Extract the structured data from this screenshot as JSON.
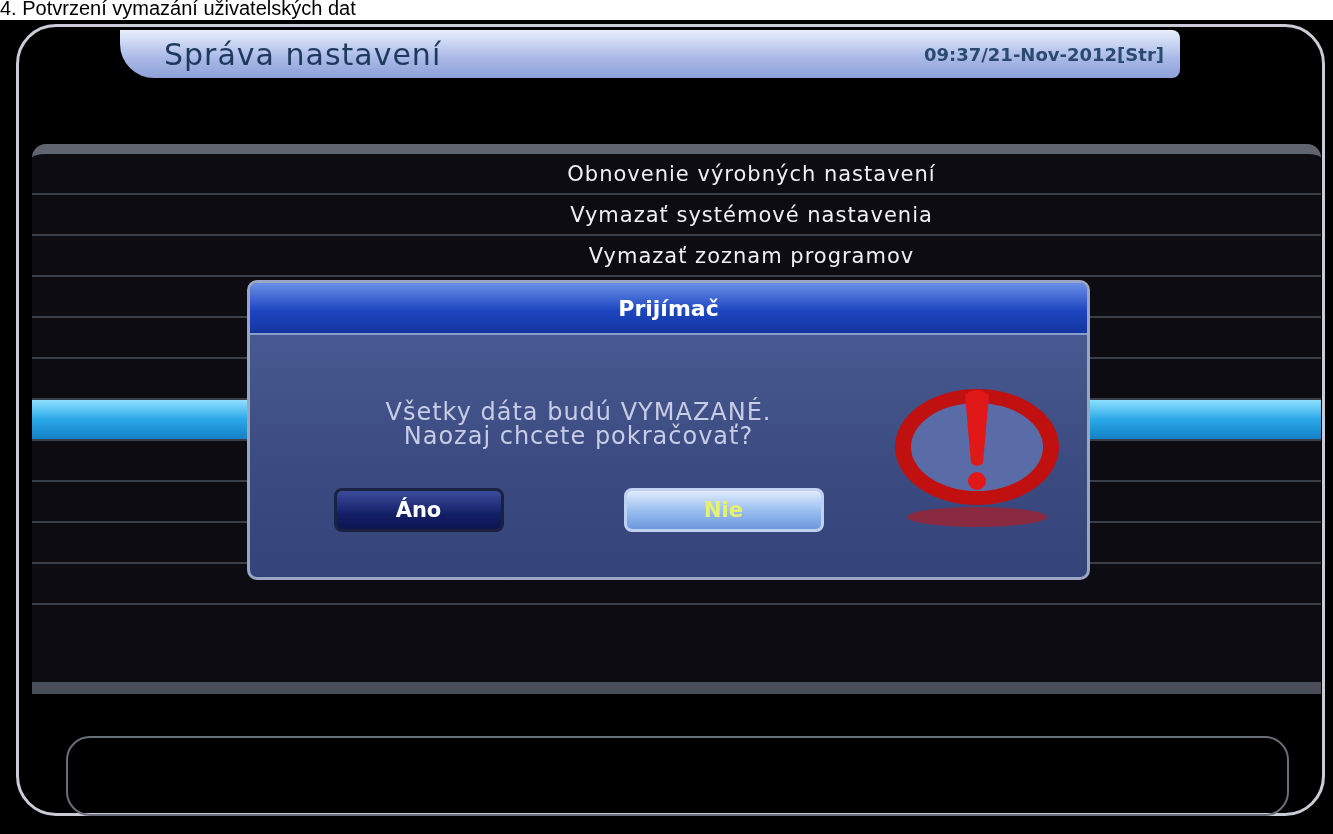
{
  "caption": "4.   Potvrzení vymazání uživatelských dat",
  "header": {
    "title": "Správa nastavení",
    "datetime": "09:37/21-Nov-2012[Str]"
  },
  "menu": {
    "items": [
      {
        "label": "Obnovenie výrobných nastavení",
        "selected": false
      },
      {
        "label": "Vymazať systémové nastavenia",
        "selected": false
      },
      {
        "label": "Vymazať zoznam programov",
        "selected": false
      }
    ]
  },
  "dialog": {
    "title": "Prijímač",
    "message_lines": [
      "Všetky dáta budú VYMAZANÉ.",
      "Naozaj chcete pokračovať?"
    ],
    "buttons": [
      {
        "label": "Áno",
        "selected": false
      },
      {
        "label": "Nie",
        "selected": true
      }
    ]
  }
}
